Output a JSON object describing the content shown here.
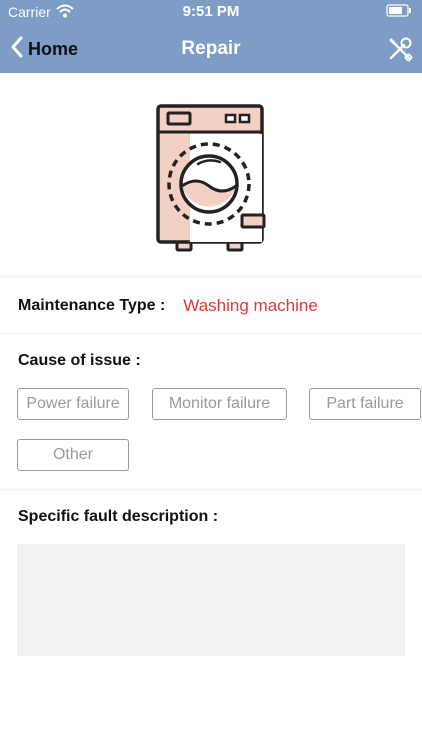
{
  "status_bar": {
    "carrier": "Carrier",
    "time": "9:51 PM"
  },
  "nav": {
    "back_label": "Home",
    "title": "Repair",
    "back_icon": "chevron-left-icon",
    "tools_icon": "wrench-screwdriver-icon"
  },
  "maintenance": {
    "label": "Maintenance Type :",
    "value": "Washing machine"
  },
  "cause": {
    "label": "Cause of issue :",
    "options": [
      "Power failure",
      "Monitor failure",
      "Part failure",
      "Other"
    ]
  },
  "description": {
    "label": "Specific fault description  :",
    "value": ""
  },
  "colors": {
    "header": "#7d9dc6",
    "accent": "#e03a36",
    "machine_fill": "#f4cfc3"
  }
}
